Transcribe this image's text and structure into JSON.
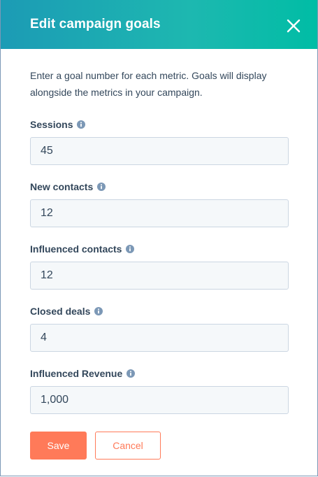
{
  "dialog": {
    "title": "Edit campaign goals",
    "close_icon": "close-icon",
    "intro": "Enter a goal number for each metric. Goals will display alongside the metrics in your campaign.",
    "fields": [
      {
        "label": "Sessions",
        "value": "45",
        "icon": "info-icon"
      },
      {
        "label": "New contacts",
        "value": "12",
        "icon": "info-icon"
      },
      {
        "label": "Influenced contacts",
        "value": "12",
        "icon": "info-icon"
      },
      {
        "label": "Closed deals",
        "value": "4",
        "icon": "info-icon"
      },
      {
        "label": "Influenced Revenue",
        "value": "1,000",
        "icon": "info-icon"
      }
    ],
    "buttons": {
      "save": "Save",
      "cancel": "Cancel"
    }
  },
  "colors": {
    "header_gradient_start": "#1c9bb5",
    "header_gradient_end": "#00bda5",
    "primary_accent": "#ff7a59",
    "text": "#33475b",
    "input_bg": "#f5f8fa",
    "input_border": "#cbd6e2",
    "info_icon": "#7c98b6"
  }
}
